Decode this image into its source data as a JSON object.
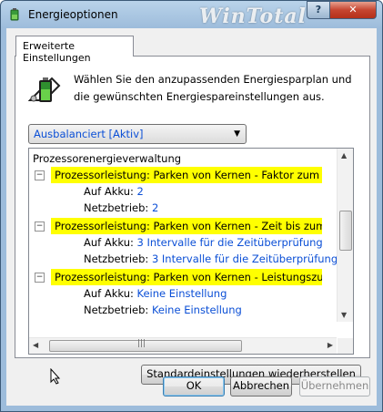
{
  "window": {
    "title": "Energieoptionen",
    "watermark": "WinTotal",
    "help_label": "?",
    "close_label": "✕"
  },
  "tab": {
    "label": "Erweiterte Einstellungen"
  },
  "intro": {
    "text": "Wählen Sie den anzupassenden Energiesparplan und die gewünschten Energiespareinstellungen aus."
  },
  "plan_select": {
    "value": "Ausbalanciert [Aktiv]"
  },
  "tree": {
    "root": "Prozessorenergieverwaltung",
    "groups": [
      {
        "title": "Prozessorleistung: Parken von Kernen - Faktor zum Reduzie",
        "settings": [
          {
            "label": "Auf Akku:",
            "value": "2"
          },
          {
            "label": "Netzbetrieb:",
            "value": "2"
          }
        ]
      },
      {
        "title": "Prozessorleistung: Parken von Kernen - Zeit bis zum Erhöhe",
        "settings": [
          {
            "label": "Auf Akku:",
            "value": "3 Intervalle für die Zeitüberprüfung"
          },
          {
            "label": "Netzbetrieb:",
            "value": "3 Intervalle für die Zeitüberprüfung"
          }
        ]
      },
      {
        "title": "Prozessorleistung: Parken von Kernen - Leistungszustand b",
        "settings": [
          {
            "label": "Auf Akku:",
            "value": "Keine Einstellung"
          },
          {
            "label": "Netzbetrieb:",
            "value": "Keine Einstellung"
          }
        ]
      }
    ]
  },
  "buttons": {
    "restore": "Standardeinstellungen wiederherstellen",
    "ok": "OK",
    "cancel": "Abbrechen",
    "apply": "Übernehmen"
  },
  "colors": {
    "highlight": "#ffff00",
    "link_value": "#0b4fd6"
  },
  "icons": [
    "power-options-icon",
    "battery-icon",
    "help-icon",
    "close-icon",
    "collapse-icon",
    "scroll-arrow-icon",
    "mouse-cursor-icon"
  ]
}
